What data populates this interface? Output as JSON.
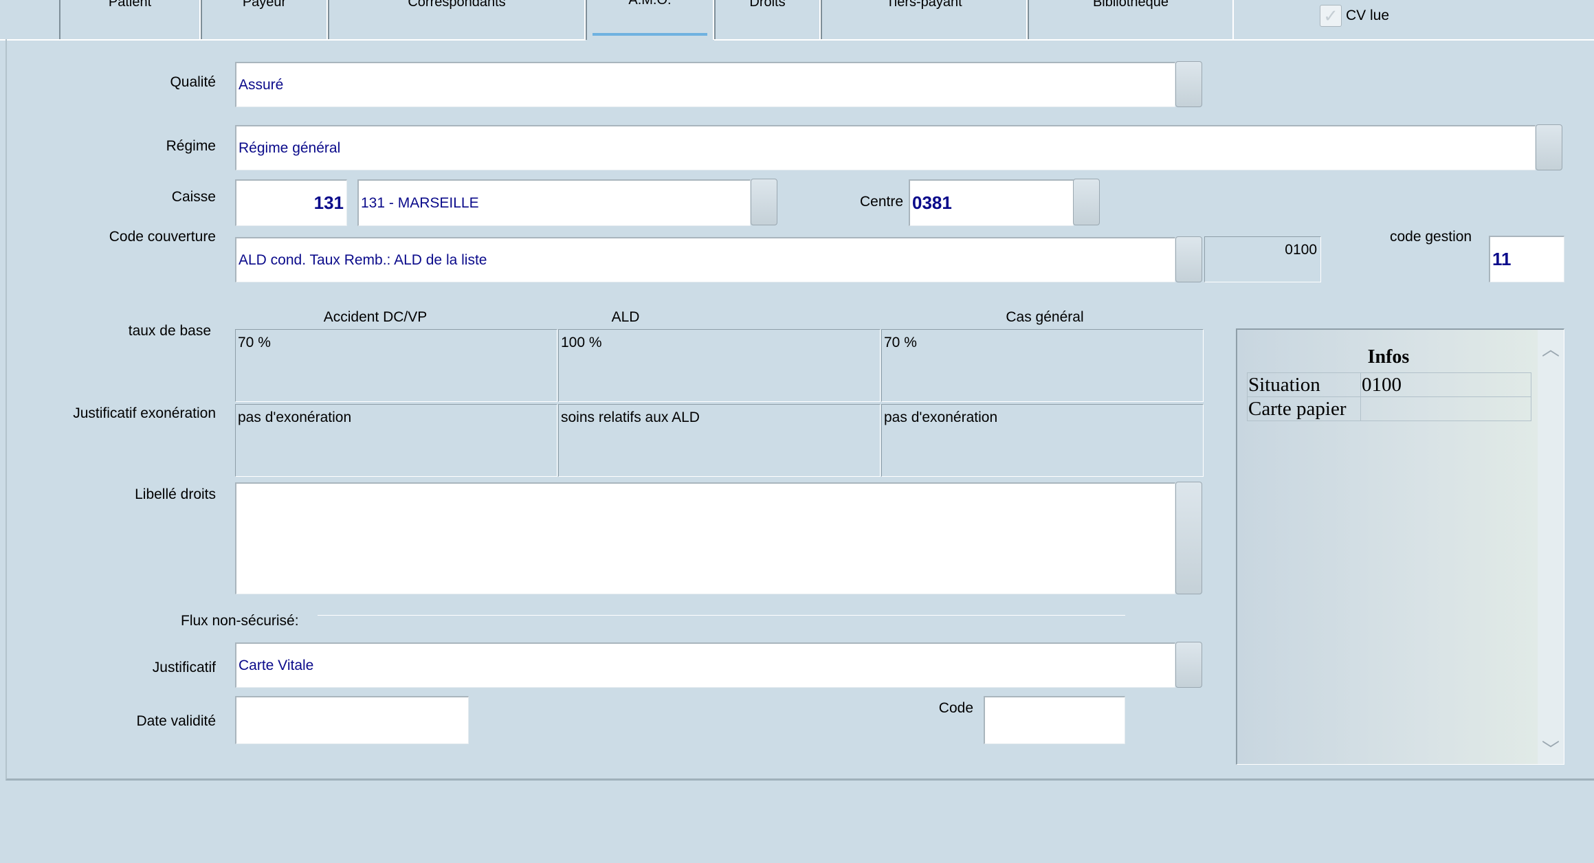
{
  "tabs": [
    {
      "label": "Patient"
    },
    {
      "label": "Payeur"
    },
    {
      "label": "Correspondants"
    },
    {
      "label": "A.M.O.",
      "active": true
    },
    {
      "label": "Droits"
    },
    {
      "label": "Tiers-payant"
    },
    {
      "label": "Bibliothèque"
    }
  ],
  "cv_lue": {
    "label": "CV lue",
    "checked": true
  },
  "form": {
    "qualite": {
      "label": "Qualité",
      "value": "Assuré"
    },
    "regime": {
      "label": "Régime",
      "value": "Régime général"
    },
    "caisse": {
      "label": "Caisse",
      "code": "131",
      "name": "131 - MARSEILLE"
    },
    "centre": {
      "label": "Centre",
      "value": "0381"
    },
    "code_couverture": {
      "label": "Code couverture",
      "value": "ALD cond. Taux Remb.: ALD de la liste",
      "code": "0100"
    },
    "code_gestion": {
      "label": "code gestion",
      "value": "11"
    },
    "columns": [
      "Accident DC/VP",
      "ALD",
      "Cas général"
    ],
    "taux_de_base": {
      "label": "taux de base",
      "values": [
        "70 %",
        "100 %",
        "70 %"
      ]
    },
    "justificatif_exoneration": {
      "label": "Justificatif exonération",
      "values": [
        "pas d'exonération",
        "soins relatifs aux ALD",
        "pas d'exonération"
      ]
    },
    "libelle_droits": {
      "label": "Libellé droits",
      "value": ""
    },
    "flux": {
      "label": "Flux non-sécurisé:"
    },
    "justificatif": {
      "label": "Justificatif",
      "value": "Carte Vitale"
    },
    "date_validite": {
      "label": "Date validité",
      "value": ""
    },
    "code": {
      "label": "Code",
      "value": ""
    }
  },
  "infos": {
    "title": "Infos",
    "rows": [
      {
        "key": "Situation",
        "value": "0100"
      },
      {
        "key": "Carte papier",
        "value": ""
      }
    ]
  }
}
